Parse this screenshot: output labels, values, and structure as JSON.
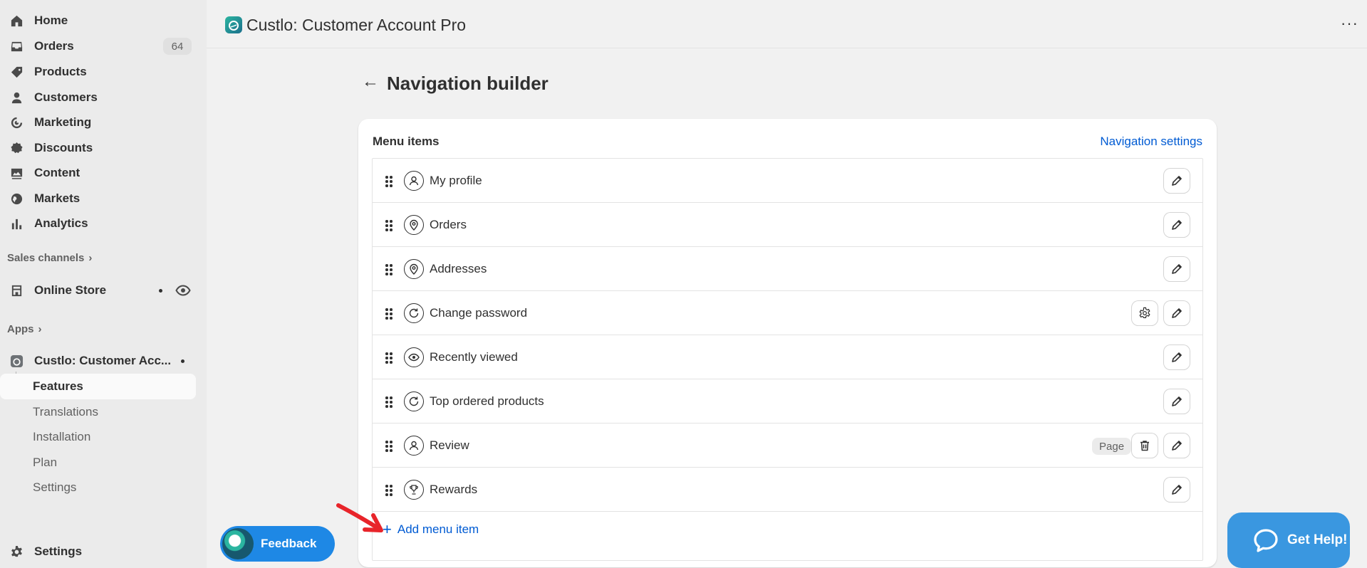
{
  "sidebar": {
    "nav": [
      {
        "label": "Home",
        "icon": "home-icon"
      },
      {
        "label": "Orders",
        "icon": "inbox-icon",
        "count": "64"
      },
      {
        "label": "Products",
        "icon": "tag-icon"
      },
      {
        "label": "Customers",
        "icon": "person-icon"
      },
      {
        "label": "Marketing",
        "icon": "target-icon"
      },
      {
        "label": "Discounts",
        "icon": "discount-icon"
      },
      {
        "label": "Content",
        "icon": "image-icon"
      },
      {
        "label": "Markets",
        "icon": "globe-icon"
      },
      {
        "label": "Analytics",
        "icon": "bar-chart-icon"
      }
    ],
    "sales_channels_label": "Sales channels",
    "online_store_label": "Online Store",
    "apps_label": "Apps",
    "app_name": "Custlo: Customer Acc...",
    "app_subitems": {
      "features": "Features",
      "translations": "Translations",
      "installation": "Installation",
      "plan": "Plan",
      "settings": "Settings"
    },
    "settings_label": "Settings"
  },
  "topbar": {
    "app_title": "Custlo: Customer Account Pro",
    "more_label": "···"
  },
  "page": {
    "back": "←",
    "title": "Navigation builder"
  },
  "card": {
    "title": "Menu items",
    "link": "Navigation settings",
    "items": [
      {
        "label": "My profile",
        "icon": "user-icon"
      },
      {
        "label": "Orders",
        "icon": "location-pin-icon"
      },
      {
        "label": "Addresses",
        "icon": "location-pin-icon"
      },
      {
        "label": "Change password",
        "icon": "refresh-icon",
        "has_settings": true
      },
      {
        "label": "Recently viewed",
        "icon": "eye-icon"
      },
      {
        "label": "Top ordered products",
        "icon": "refresh-icon"
      },
      {
        "label": "Review",
        "icon": "user-icon",
        "badge": "Page",
        "has_delete": true
      },
      {
        "label": "Rewards",
        "icon": "trophy-icon"
      }
    ],
    "add_label": "Add menu item"
  },
  "feedback": {
    "label": "Feedback"
  },
  "help": {
    "label": "Get Help!"
  },
  "colors": {
    "link": "#005bd3",
    "feedback": "#1e88e5",
    "help": "#3a97e0",
    "annotation_arrow": "#e8242a"
  }
}
